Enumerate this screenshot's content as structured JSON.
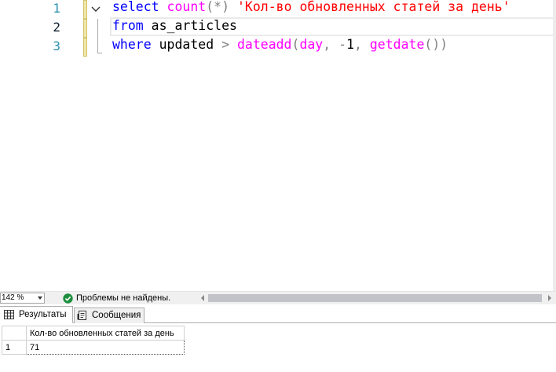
{
  "editor": {
    "line_numbers": [
      "1",
      "2",
      "3"
    ],
    "lines": [
      [
        {
          "text": "select",
          "cls": "kw"
        },
        {
          "text": " ",
          "cls": "plain"
        },
        {
          "text": "count",
          "cls": "fn"
        },
        {
          "text": "(*)",
          "cls": "op"
        },
        {
          "text": " ",
          "cls": "plain"
        },
        {
          "text": "'Кол-во обновленных статей за день'",
          "cls": "str"
        }
      ],
      [
        {
          "text": "from",
          "cls": "kw"
        },
        {
          "text": " as_articles",
          "cls": "plain"
        }
      ],
      [
        {
          "text": "where",
          "cls": "kw"
        },
        {
          "text": " updated ",
          "cls": "plain"
        },
        {
          "text": ">",
          "cls": "op"
        },
        {
          "text": " ",
          "cls": "plain"
        },
        {
          "text": "dateadd",
          "cls": "fn"
        },
        {
          "text": "(",
          "cls": "op"
        },
        {
          "text": "day",
          "cls": "fn"
        },
        {
          "text": ",",
          "cls": "op"
        },
        {
          "text": " ",
          "cls": "plain"
        },
        {
          "text": "-",
          "cls": "op"
        },
        {
          "text": "1",
          "cls": "plain"
        },
        {
          "text": ",",
          "cls": "op"
        },
        {
          "text": " ",
          "cls": "plain"
        },
        {
          "text": "getdate",
          "cls": "fn"
        },
        {
          "text": "())",
          "cls": "op"
        }
      ]
    ],
    "current_line": 2,
    "colors": {
      "keyword": "#0000ff",
      "function": "#ff00ff",
      "string": "#ff0000",
      "operator": "#808080",
      "line_number": "#2b91af"
    }
  },
  "status": {
    "zoom": "142 %",
    "message": "Проблемы не найдены.",
    "ok_icon": "check-circle-icon"
  },
  "results": {
    "tabs": [
      {
        "label": "Результаты",
        "icon": "grid-icon"
      },
      {
        "label": "Сообщения",
        "icon": "messages-icon"
      }
    ],
    "columns": [
      "Кол-во обновленных статей за день"
    ],
    "rows": [
      {
        "num": "1",
        "cells": [
          "71"
        ]
      }
    ]
  }
}
